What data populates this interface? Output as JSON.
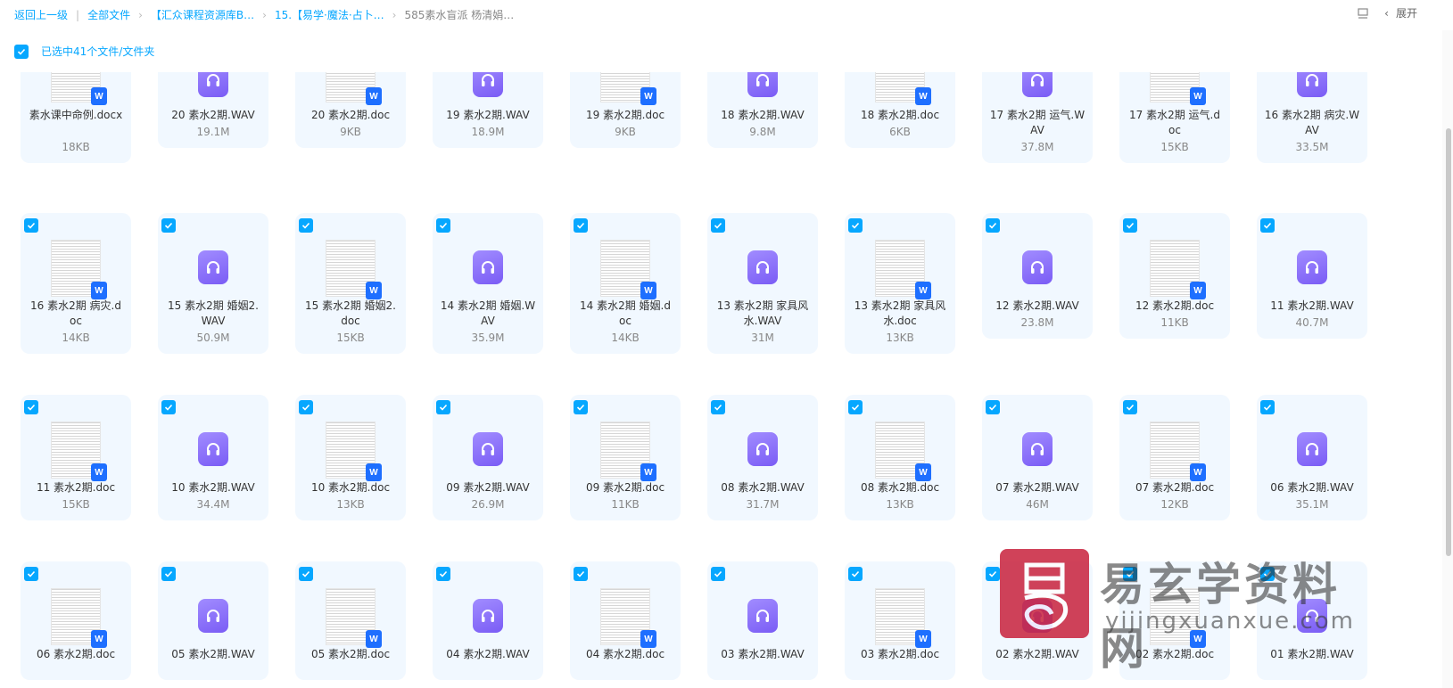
{
  "breadcrumb": {
    "back": "返回上一级",
    "items": [
      "全部文件",
      "【汇众课程资源库B…",
      "15.【易学·魔法·占卜…"
    ],
    "current": "585素水盲派 杨清娟…"
  },
  "toolbar": {
    "expand_label": "展开"
  },
  "selection": {
    "label": "已选中41个文件/文件夹"
  },
  "rows": [
    [
      {
        "type": "doc",
        "name": "素水课中命例.docx",
        "size": "18KB",
        "checked": false
      },
      {
        "type": "wav",
        "name": "20 素水2期.WAV",
        "size": "19.1M",
        "checked": false
      },
      {
        "type": "doc",
        "name": "20 素水2期.doc",
        "size": "9KB",
        "checked": false
      },
      {
        "type": "wav",
        "name": "19 素水2期.WAV",
        "size": "18.9M",
        "checked": false
      },
      {
        "type": "doc",
        "name": "19 素水2期.doc",
        "size": "9KB",
        "checked": false
      },
      {
        "type": "wav",
        "name": "18 素水2期.WAV",
        "size": "9.8M",
        "checked": false
      },
      {
        "type": "doc",
        "name": "18 素水2期.doc",
        "size": "6KB",
        "checked": false
      },
      {
        "type": "wav",
        "name": "17 素水2期 运气.WAV",
        "size": "37.8M",
        "checked": false
      },
      {
        "type": "doc",
        "name": "17 素水2期 运气.doc",
        "size": "15KB",
        "checked": false
      },
      {
        "type": "wav",
        "name": "16 素水2期 病灾.WAV",
        "size": "33.5M",
        "checked": false
      }
    ],
    [
      {
        "type": "doc",
        "name": "16 素水2期 病灾.doc",
        "size": "14KB",
        "checked": true
      },
      {
        "type": "wav",
        "name": "15 素水2期 婚姻2.WAV",
        "size": "50.9M",
        "checked": true
      },
      {
        "type": "doc",
        "name": "15 素水2期 婚姻2.doc",
        "size": "15KB",
        "checked": true
      },
      {
        "type": "wav",
        "name": "14 素水2期 婚姻.WAV",
        "size": "35.9M",
        "checked": true
      },
      {
        "type": "doc",
        "name": "14 素水2期 婚姻.doc",
        "size": "14KB",
        "checked": true
      },
      {
        "type": "wav",
        "name": "13 素水2期 家具风水.WAV",
        "size": "31M",
        "checked": true
      },
      {
        "type": "doc",
        "name": "13 素水2期 家具风水.doc",
        "size": "13KB",
        "checked": true
      },
      {
        "type": "wav",
        "name": "12 素水2期.WAV",
        "size": "23.8M",
        "checked": true
      },
      {
        "type": "doc",
        "name": "12 素水2期.doc",
        "size": "11KB",
        "checked": true
      },
      {
        "type": "wav",
        "name": "11 素水2期.WAV",
        "size": "40.7M",
        "checked": true
      }
    ],
    [
      {
        "type": "doc",
        "name": "11 素水2期.doc",
        "size": "15KB",
        "checked": true
      },
      {
        "type": "wav",
        "name": "10 素水2期.WAV",
        "size": "34.4M",
        "checked": true
      },
      {
        "type": "doc",
        "name": "10 素水2期.doc",
        "size": "13KB",
        "checked": true
      },
      {
        "type": "wav",
        "name": "09 素水2期.WAV",
        "size": "26.9M",
        "checked": true
      },
      {
        "type": "doc",
        "name": "09 素水2期.doc",
        "size": "11KB",
        "checked": true
      },
      {
        "type": "wav",
        "name": "08 素水2期.WAV",
        "size": "31.7M",
        "checked": true
      },
      {
        "type": "doc",
        "name": "08 素水2期.doc",
        "size": "13KB",
        "checked": true
      },
      {
        "type": "wav",
        "name": "07 素水2期.WAV",
        "size": "46M",
        "checked": true
      },
      {
        "type": "doc",
        "name": "07 素水2期.doc",
        "size": "12KB",
        "checked": true
      },
      {
        "type": "wav",
        "name": "06 素水2期.WAV",
        "size": "35.1M",
        "checked": true
      }
    ],
    [
      {
        "type": "doc",
        "name": "06 素水2期.doc",
        "size": "",
        "checked": true
      },
      {
        "type": "wav",
        "name": "05 素水2期.WAV",
        "size": "",
        "checked": true
      },
      {
        "type": "doc",
        "name": "05 素水2期.doc",
        "size": "",
        "checked": true
      },
      {
        "type": "wav",
        "name": "04 素水2期.WAV",
        "size": "",
        "checked": true
      },
      {
        "type": "doc",
        "name": "04 素水2期.doc",
        "size": "",
        "checked": true
      },
      {
        "type": "wav",
        "name": "03 素水2期.WAV",
        "size": "",
        "checked": true
      },
      {
        "type": "doc",
        "name": "03 素水2期.doc",
        "size": "",
        "checked": true
      },
      {
        "type": "wav",
        "name": "02 素水2期.WAV",
        "size": "",
        "checked": true
      },
      {
        "type": "doc",
        "name": "02 素水2期.doc",
        "size": "",
        "checked": true
      },
      {
        "type": "wav",
        "name": "01 素水2期.WAV",
        "size": "",
        "checked": true
      }
    ]
  ],
  "watermark": {
    "title": "易玄学资料网",
    "url": "yijingxuanxue.com"
  },
  "colors": {
    "accent": "#06a7ff",
    "card_bg": "#f1f8ff",
    "audio_icon": "#8a6dff",
    "word_badge": "#1e6fff"
  }
}
